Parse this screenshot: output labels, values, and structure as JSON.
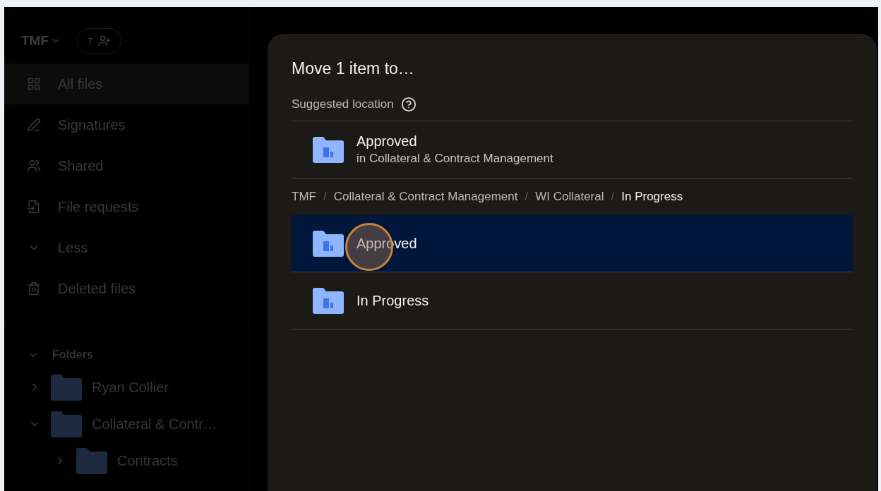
{
  "workspace": {
    "name": "TMF",
    "member_count": "7"
  },
  "nav": [
    {
      "label": "All files",
      "selected": true
    },
    {
      "label": "Signatures",
      "selected": false
    },
    {
      "label": "Shared",
      "selected": false
    },
    {
      "label": "File requests",
      "selected": false
    },
    {
      "label": "Less",
      "selected": false
    },
    {
      "label": "Deleted files",
      "selected": false
    }
  ],
  "folders": {
    "label": "Folders",
    "expanded": true,
    "children": [
      {
        "label": "Ryan Collier",
        "expanded": false
      },
      {
        "label": "Collateral & Contr…",
        "expanded": true,
        "children": [
          {
            "label": "Contracts",
            "expanded": false
          }
        ]
      }
    ]
  },
  "dialog": {
    "title": "Move 1 item to…",
    "suggested_label": "Suggested location",
    "suggested": {
      "name": "Approved",
      "location": "in Collateral & Contract Management"
    },
    "breadcrumb": [
      {
        "label": "TMF",
        "current": false
      },
      {
        "separator": "/",
        "label": "Collateral & Contract Management",
        "current": false
      },
      {
        "separator": "/",
        "label": "WI Collateral",
        "current": false
      },
      {
        "separator": "/",
        "label": "In Progress",
        "current": true
      }
    ],
    "folders": [
      {
        "name": "Approved",
        "selected": true
      },
      {
        "name": "In Progress",
        "selected": false
      }
    ]
  }
}
